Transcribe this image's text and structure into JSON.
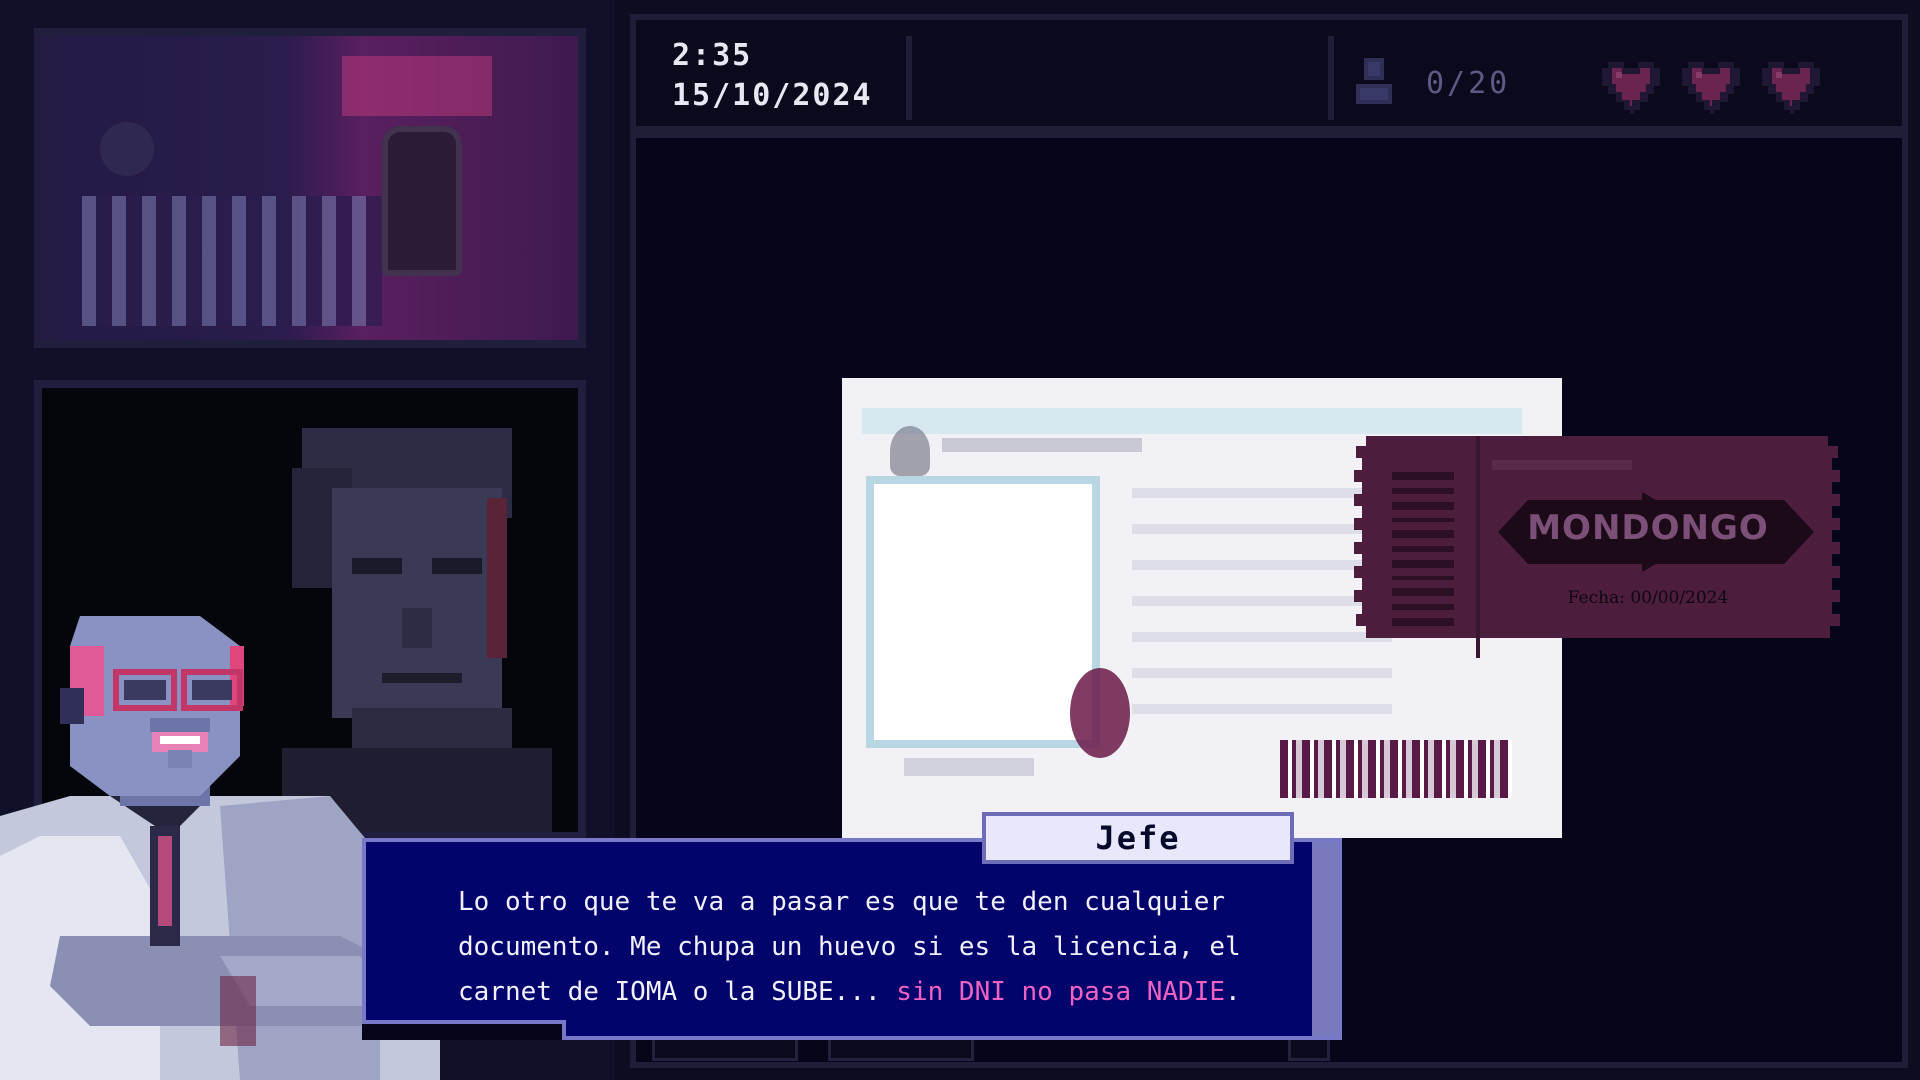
{
  "hud": {
    "time": "2:35",
    "date": "15/10/2024",
    "people_count": "0/20",
    "people_icon": "person-icon",
    "lives": 3,
    "heart_color": "#6b2450"
  },
  "desk": {
    "ticket": {
      "title": "MONDONGO",
      "date_text": "Fecha: 00/00/2024",
      "color": "#4d1d3d"
    }
  },
  "dialog": {
    "speaker": "Jefe",
    "text_plain": "Lo otro que te va a pasar es que te den cualquier\ndocumento. Me chupa un huevo si es la licencia, el\ncarnet de IOMA o la SUBE... ",
    "text_highlight": "sin DNI no pasa NADIE",
    "text_end": ".",
    "highlight_color": "#ee62c4"
  }
}
